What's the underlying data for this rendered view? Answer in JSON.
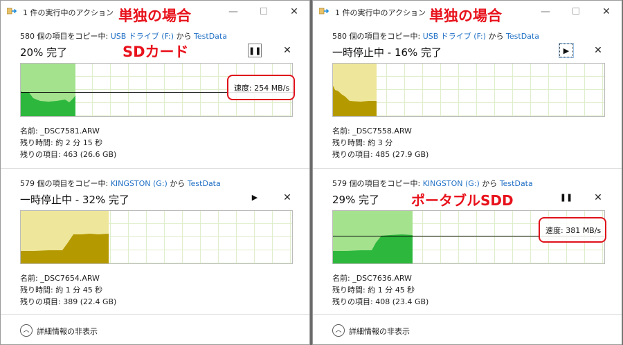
{
  "colors": {
    "accent_red": "#e8121c",
    "link_blue": "#1f6fc5",
    "graph_green": "#2db83d",
    "graph_green_light": "#a4e28e",
    "graph_paused_dark": "#b49a00",
    "graph_paused_light": "#eee69a"
  },
  "windows": [
    {
      "title": "1 件の実行中のアクション",
      "heading_label": "単独の場合",
      "footer_label": "詳細情報の非表示",
      "panels": [
        {
          "src_prefix": "580 個の項目をコピー中: ",
          "src_device": "USB ドライブ (F:)",
          "src_mid": " から ",
          "src_dest": "TestData",
          "progress_text": "20% 完了",
          "progress_percent": 20,
          "state": "running",
          "control_icon": "pause-icon",
          "control_glyph": "❚❚",
          "close_glyph": "✕",
          "speed": "速度: 254 MB/s",
          "name": "名前: _DSC7581.ARW",
          "time_left": "残り時間: 約 2 分 15 秒",
          "items_left": "残りの項目: 463 (26.6 GB)",
          "device_label": "SDカード"
        },
        {
          "src_prefix": "579 個の項目をコピー中: ",
          "src_device": "KINGSTON (G:)",
          "src_mid": " から ",
          "src_dest": "TestData",
          "progress_text": "一時停止中 - 32% 完了",
          "progress_percent": 32,
          "state": "paused",
          "control_icon": "play-icon",
          "control_glyph": "▶",
          "close_glyph": "✕",
          "name": "名前: _DSC7654.ARW",
          "time_left": "残り時間: 約 1 分 45 秒",
          "items_left": "残りの項目: 389 (22.4 GB)"
        }
      ]
    },
    {
      "title": "1 件の実行中のアクション",
      "heading_label": "単独の場合",
      "footer_label": "詳細情報の非表示",
      "panels": [
        {
          "src_prefix": "580 個の項目をコピー中: ",
          "src_device": "USB ドライブ (F:)",
          "src_mid": " から ",
          "src_dest": "TestData",
          "progress_text": "一時停止中 - 16% 完了",
          "progress_percent": 16,
          "state": "paused",
          "control_icon": "play-icon",
          "control_glyph": "▶",
          "close_glyph": "✕",
          "name": "名前: _DSC7558.ARW",
          "time_left": "残り時間: 約 3 分",
          "items_left": "残りの項目: 485 (27.9 GB)"
        },
        {
          "src_prefix": "579 個の項目をコピー中: ",
          "src_device": "KINGSTON (G:)",
          "src_mid": " から ",
          "src_dest": "TestData",
          "progress_text": "29% 完了",
          "progress_percent": 29,
          "state": "running",
          "control_icon": "pause-icon",
          "control_glyph": "❚❚",
          "close_glyph": "✕",
          "speed": "速度: 381 MB/s",
          "name": "名前: _DSC7636.ARW",
          "time_left": "残り時間: 約 1 分 45 秒",
          "items_left": "残りの項目: 408 (23.4 GB)",
          "device_label": "ポータブルSDD"
        }
      ]
    }
  ]
}
